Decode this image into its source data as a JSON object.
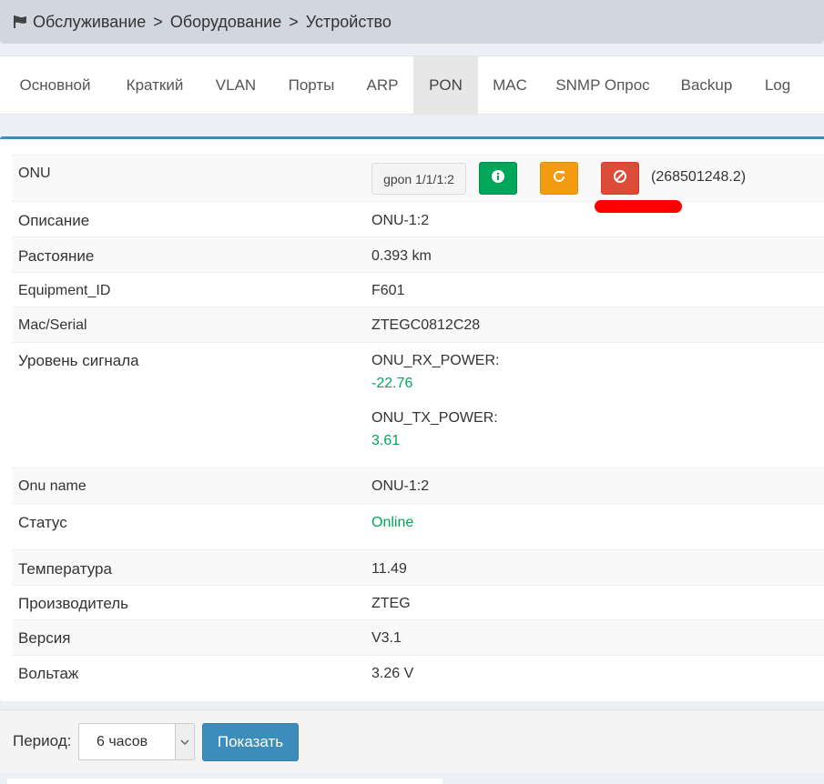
{
  "breadcrumb": {
    "icon": "flag-icon",
    "items": [
      "Обслуживание",
      "Оборудование",
      "Устройство"
    ],
    "separator": ">"
  },
  "tabs": [
    {
      "label": "Основной",
      "active": false
    },
    {
      "label": "Краткий",
      "active": false
    },
    {
      "label": "VLAN",
      "active": false
    },
    {
      "label": "Порты",
      "active": false
    },
    {
      "label": "ARP",
      "active": false
    },
    {
      "label": "PON",
      "active": true
    },
    {
      "label": "MAC",
      "active": false
    },
    {
      "label": "SNMP Опрос",
      "active": false
    },
    {
      "label": "Backup",
      "active": false
    },
    {
      "label": "Log",
      "active": false
    }
  ],
  "onu": {
    "label": "ONU",
    "port_button": "gpon 1/1/1:2",
    "actions": {
      "info_icon": "info-icon",
      "reload_icon": "refresh-icon",
      "block_icon": "ban-icon"
    },
    "id_text": "(268501248.2)"
  },
  "details": {
    "description": {
      "label": "Описание",
      "value": "ONU-1:2"
    },
    "distance": {
      "label": "Растояние",
      "value": "0.393 km"
    },
    "equipment_id": {
      "label": "Equipment_ID",
      "value": "F601"
    },
    "mac_serial": {
      "label": "Mac/Serial",
      "value": "ZTEGC0812C28"
    },
    "signal": {
      "label": "Уровень сигнала",
      "rx_label": "ONU_RX_POWER:",
      "rx_value": "-22.76",
      "tx_label": "ONU_TX_POWER:",
      "tx_value": "3.61"
    },
    "onu_name": {
      "label": "Onu name",
      "value": "ONU-1:2"
    },
    "status": {
      "label": "Статус",
      "value": "Online"
    },
    "temperature": {
      "label": "Температура",
      "value": "11.49"
    },
    "vendor": {
      "label": "Производитель",
      "value": "ZTEG"
    },
    "version": {
      "label": "Версия",
      "value": "V3.1"
    },
    "voltage": {
      "label": "Вольтаж",
      "value": "3.26 V"
    }
  },
  "period": {
    "label": "Период:",
    "selected": "6 часов",
    "show_button": "Показать"
  },
  "colors": {
    "primary": "#3c8dbc",
    "success": "#00a65a",
    "warning": "#f39c12",
    "danger": "#dd4b39"
  }
}
